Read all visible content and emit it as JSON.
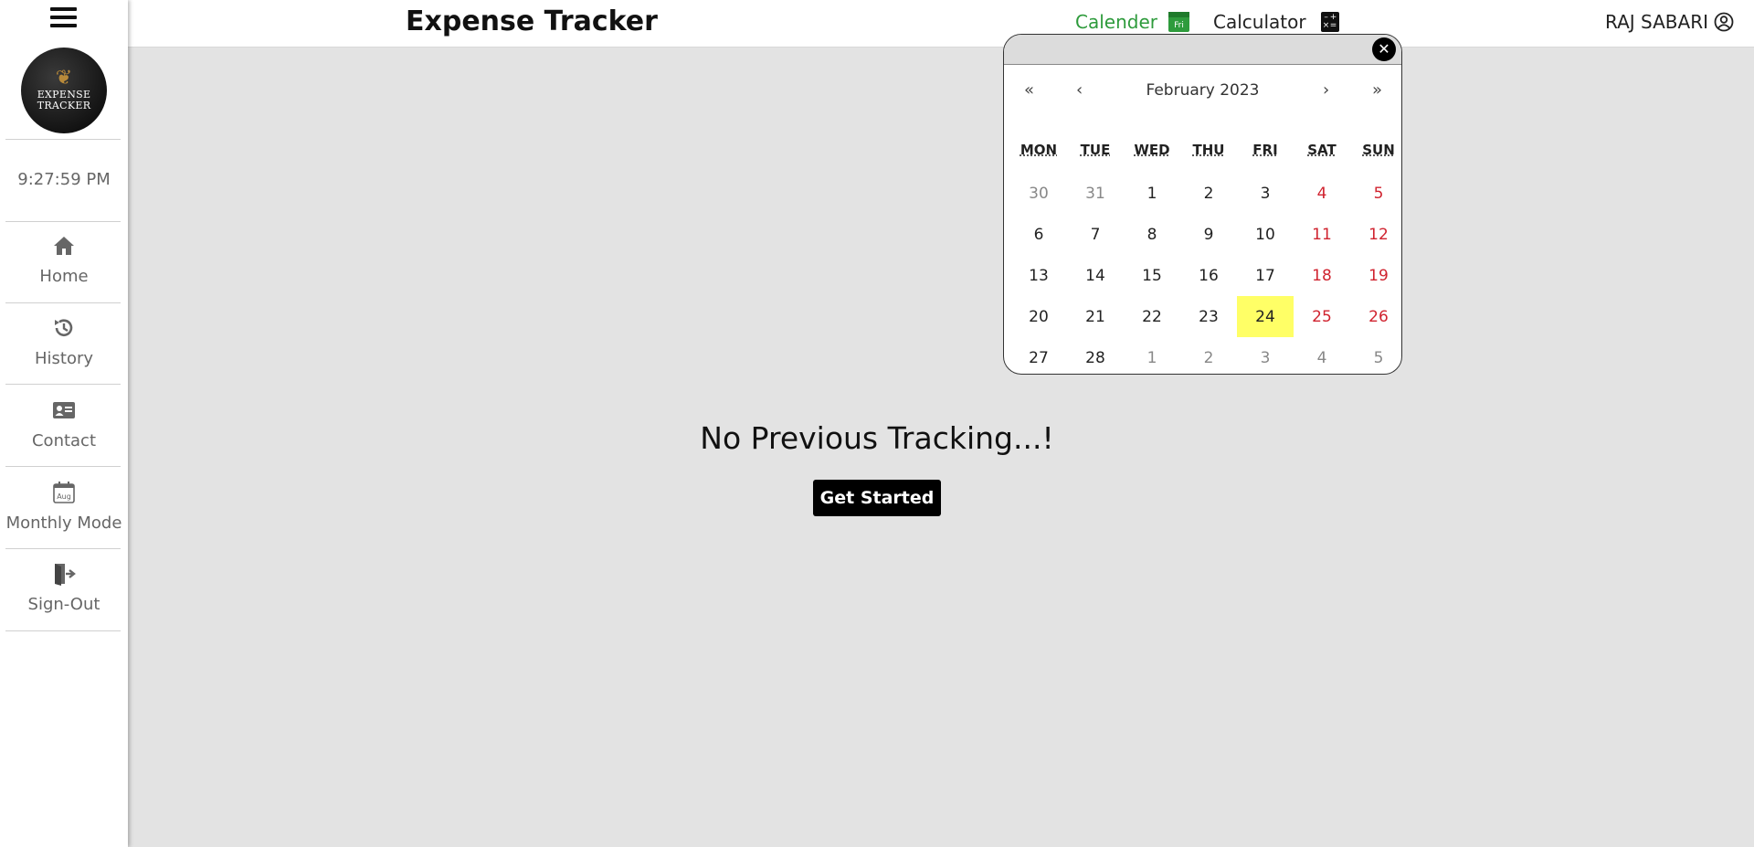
{
  "sidebar": {
    "clock": "9:27:59 PM",
    "logo_text": [
      "EXPENSE",
      "TRACKER"
    ],
    "items": [
      {
        "label": "Home",
        "icon": "home-icon"
      },
      {
        "label": "History",
        "icon": "history-icon"
      },
      {
        "label": "Contact",
        "icon": "contact-card-icon"
      },
      {
        "label": "Monthly Mode",
        "icon": "calendar-aug-icon",
        "icon_text": "Aug"
      },
      {
        "label": "Sign-Out",
        "icon": "sign-out-icon"
      }
    ]
  },
  "header": {
    "title": "Expense Tracker",
    "calendar_link": "Calender",
    "calendar_icon_text": "Fri",
    "calculator_link": "Calculator",
    "user_name": "RAJ SABARI"
  },
  "main": {
    "empty_message": "No Previous Tracking...!",
    "cta_label": "Get Started"
  },
  "calendar": {
    "nav": {
      "prev_year": "«",
      "prev_month": "‹",
      "next_month": "›",
      "next_year": "»"
    },
    "month_label": "February 2023",
    "weekdays": [
      "MON",
      "TUE",
      "WED",
      "THU",
      "FRI",
      "SAT",
      "SUN"
    ],
    "weeks": [
      [
        "30",
        "31",
        "1",
        "2",
        "3",
        "4",
        "5"
      ],
      [
        "6",
        "7",
        "8",
        "9",
        "10",
        "11",
        "12"
      ],
      [
        "13",
        "14",
        "15",
        "16",
        "17",
        "18",
        "19"
      ],
      [
        "20",
        "21",
        "22",
        "23",
        "24",
        "25",
        "26"
      ],
      [
        "27",
        "28",
        "1",
        "2",
        "3",
        "4",
        "5"
      ]
    ],
    "other_month_cells": [
      [
        0,
        0
      ],
      [
        0,
        1
      ],
      [
        4,
        2
      ],
      [
        4,
        3
      ],
      [
        4,
        4
      ],
      [
        4,
        5
      ],
      [
        4,
        6
      ]
    ],
    "today": [
      3,
      4
    ],
    "colors": {
      "weekend": "#d0232f",
      "today_bg": "#ffff66",
      "calendar_link": "#2e9b3c"
    }
  }
}
